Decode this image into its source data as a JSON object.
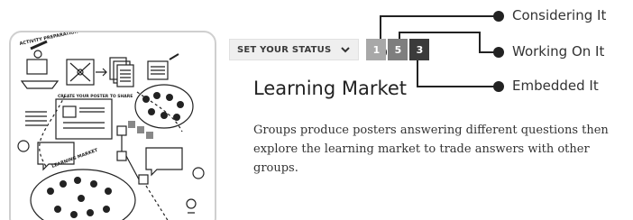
{
  "status": {
    "label": "SET YOUR STATUS",
    "chevron_icon": "chevron-down-icon",
    "boxes": [
      {
        "value": "1",
        "color": "#a8a8a8"
      },
      {
        "value": "5",
        "color": "#7e7e7e"
      },
      {
        "value": "3",
        "color": "#3b3b3b"
      }
    ]
  },
  "legend": {
    "considering": "Considering It",
    "working": "Working On It",
    "embedded": "Embedded It"
  },
  "activity": {
    "title": "Learning Market",
    "description": "Groups produce posters answering different questions then explore the learning market to trade answers with other groups."
  },
  "illustration": {
    "top_left_sign": "ACTIVITY PREPARATION",
    "poster_sign": "CREATE YOUR POSTER TO SHARE",
    "market_sign": "LEARNING MARKET"
  }
}
